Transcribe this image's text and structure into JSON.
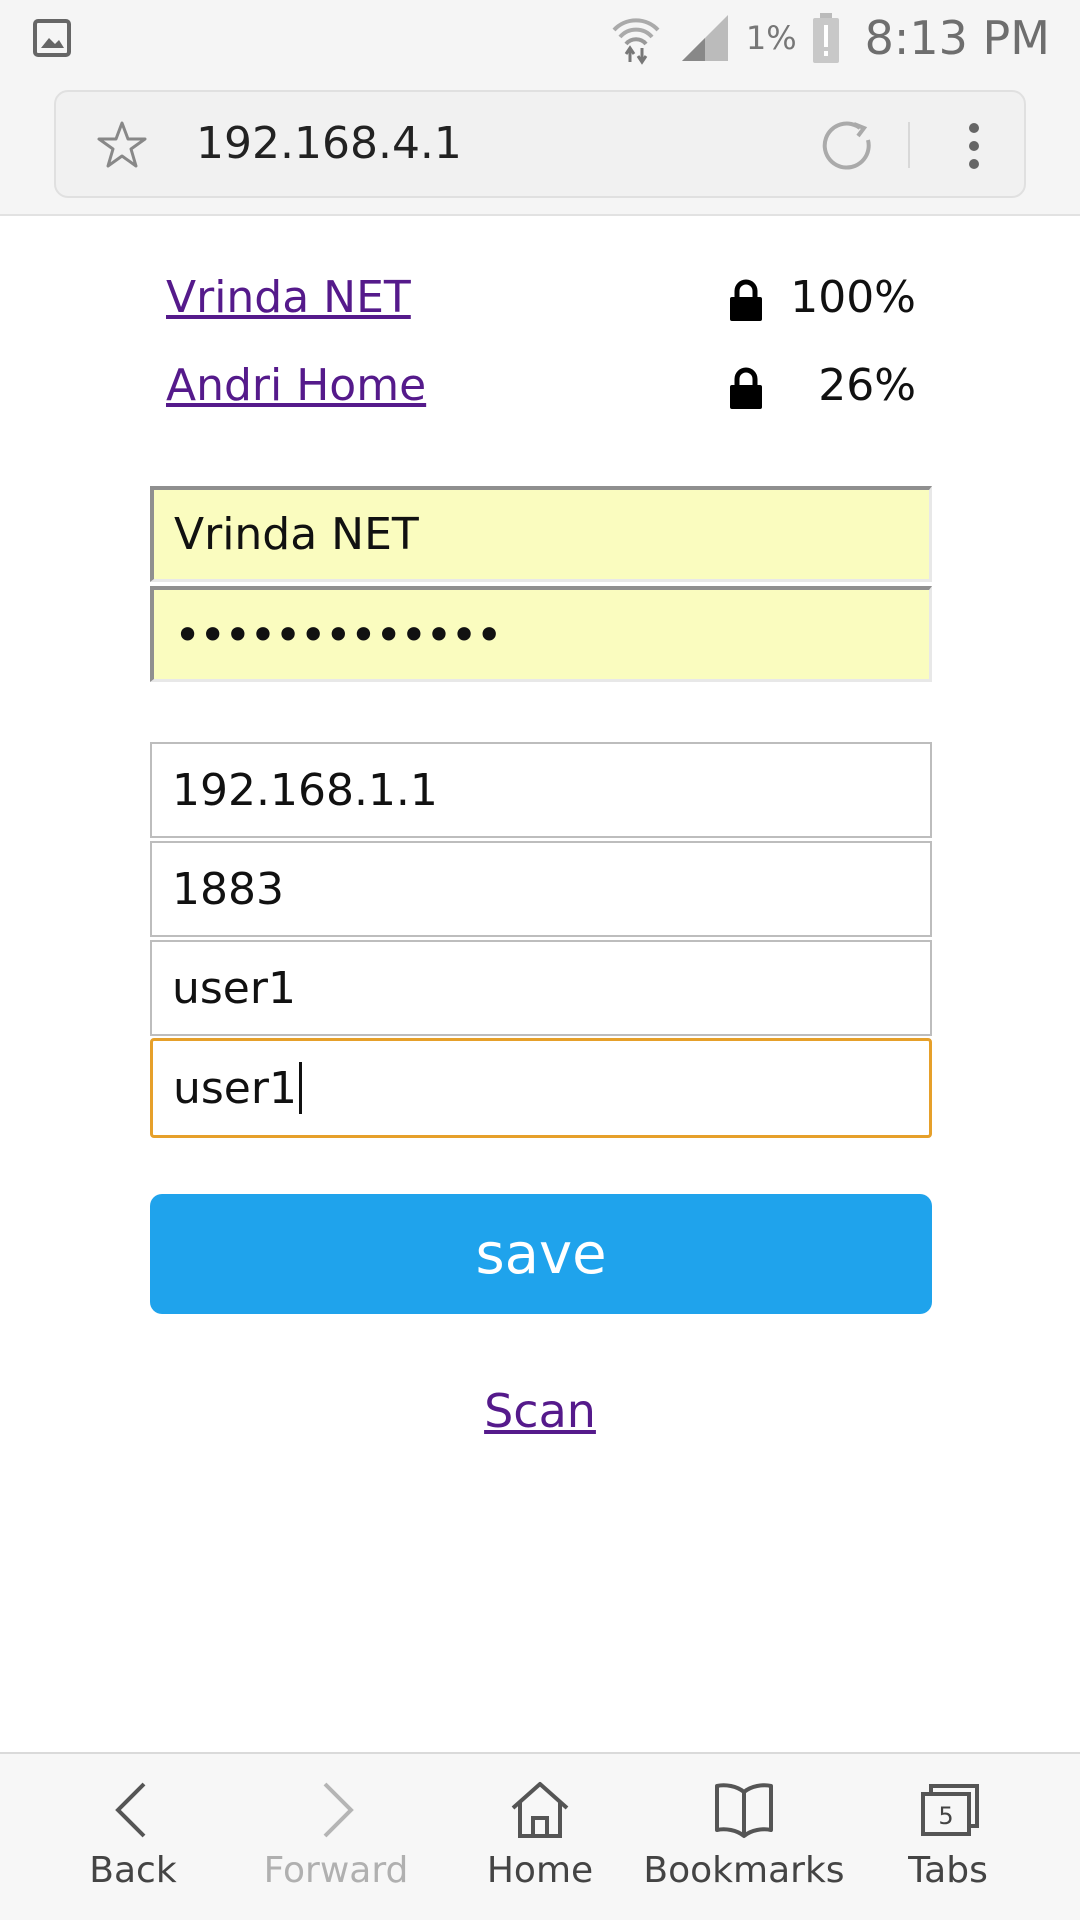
{
  "status_bar": {
    "left_icon": "image-notification-icon",
    "battery_percent": "1%",
    "time": "8:13 PM"
  },
  "browser": {
    "url": "192.168.4.1"
  },
  "networks": [
    {
      "ssid": "Vrinda NET",
      "secured": true,
      "signal": "100%"
    },
    {
      "ssid": "Andri Home",
      "secured": true,
      "signal": "26%"
    }
  ],
  "form": {
    "ssid_value": "Vrinda NET",
    "password_value": "•••••••••••••",
    "server_value": "192.168.1.1",
    "port_value": "1883",
    "user_value": "user1",
    "pass_value": "user1",
    "save_label": "save",
    "scan_label": "Scan"
  },
  "bottom_nav": {
    "back": "Back",
    "forward": "Forward",
    "home": "Home",
    "bookmarks": "Bookmarks",
    "tabs": "Tabs",
    "tab_count": "5"
  },
  "colors": {
    "save_button": "#1fa3ec",
    "visited_link": "#551a8b",
    "autofill_yellow": "#fafcbf",
    "focus_border": "#e6a02a"
  }
}
